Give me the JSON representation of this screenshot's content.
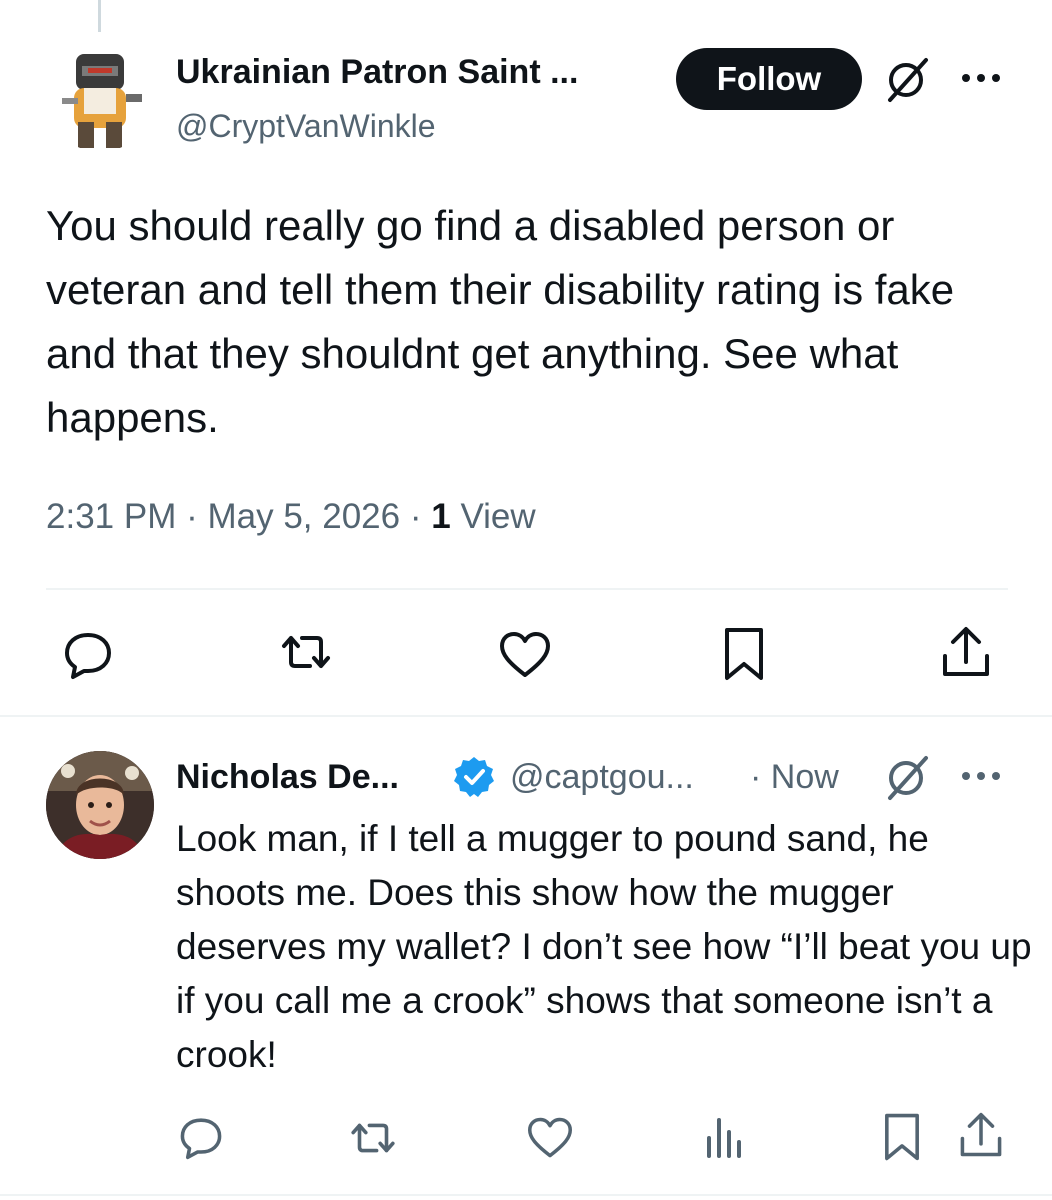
{
  "tweet": {
    "author_name": "Ukrainian Patron Saint ...",
    "author_handle": "@CryptVanWinkle",
    "follow_label": "Follow",
    "text": "You should really go find a disabled person or veteran and tell them their disability rating is fake and that they shouldnt get anything. See what happens.",
    "time": "2:31 PM",
    "date": "May 5, 2026",
    "separator": "·",
    "views_count": "1",
    "views_label": "View",
    "actions": [
      "reply-icon",
      "retweet-icon",
      "like-icon",
      "bookmark-icon",
      "share-icon"
    ]
  },
  "reply": {
    "author_name": "Nicholas De...",
    "author_handle": "@captgou...",
    "time": "· Now",
    "verified": true,
    "text": "Look man, if I tell a mugger to pound sand, he shoots me. Does this show how the mugger deserves my wallet? I don’t see how “I’ll beat you up if you call me a crook” shows that someone isn’t a crook!",
    "actions": [
      "reply-icon",
      "retweet-icon",
      "like-icon",
      "analytics-icon",
      "bookmark-icon",
      "share-icon"
    ]
  },
  "colors": {
    "text": "#0f1419",
    "secondary": "#536471",
    "verified": "#1d9bf0",
    "divider": "#eff3f4",
    "button_bg": "#0f1419",
    "button_text": "#ffffff"
  }
}
